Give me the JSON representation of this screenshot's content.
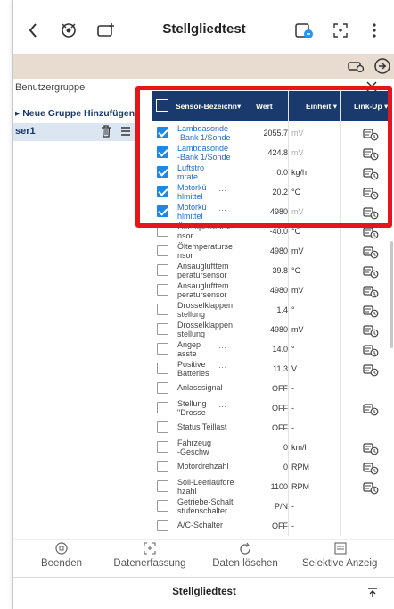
{
  "header": {
    "title": "Stellgliedtest",
    "back_icon": "chevron-left-icon",
    "icons": [
      "vehicle-settings-icon",
      "car-add-icon",
      "calendar-icon",
      "expand-icon",
      "more-vertical-icon"
    ]
  },
  "left_panel": {
    "group_label": "Benutzergruppe",
    "add_group": "▸ Neue Gruppe Hinzufügen",
    "user_name": "ser1"
  },
  "table": {
    "headers": {
      "name": "Sensor-Bezeichn▾",
      "value": "Wert",
      "unit": "Einheit ▾",
      "link": "Link-Up ▾"
    },
    "rows": [
      {
        "name": "Lambdasonde\n-Bank 1/Sonde",
        "value": "2055.7",
        "unit": "mV",
        "checked": true,
        "unit_grey": true,
        "dots": false,
        "link": true
      },
      {
        "name": "Lambdasonde\n-Bank 1/Sonde",
        "value": "424.8",
        "unit": "mV",
        "checked": true,
        "unit_grey": true,
        "dots": false,
        "link": true
      },
      {
        "name": "Luftstro\nmrate",
        "value": "0.0",
        "unit": "kg/h",
        "checked": true,
        "unit_grey": false,
        "dots": true,
        "link": true
      },
      {
        "name": "Motorkü\nhlmittel",
        "value": "20.2",
        "unit": "°C",
        "checked": true,
        "unit_grey": false,
        "dots": true,
        "link": true
      },
      {
        "name": "Motorkü\nhlmittel",
        "value": "4980",
        "unit": "mV",
        "checked": true,
        "unit_grey": true,
        "dots": true,
        "link": true
      },
      {
        "name": "Öltemperaturse\nnsor",
        "value": "-40.0",
        "unit": "°C",
        "checked": false,
        "unit_grey": false,
        "dots": false,
        "link": true
      },
      {
        "name": "Öltemperaturse\nnsor",
        "value": "4980",
        "unit": "mV",
        "checked": false,
        "unit_grey": false,
        "dots": false,
        "link": true
      },
      {
        "name": "Ansauglufttem\nperatursensor",
        "value": "39.8",
        "unit": "°C",
        "checked": false,
        "unit_grey": false,
        "dots": false,
        "link": true
      },
      {
        "name": "Ansauglufttem\nperatursensor",
        "value": "4980",
        "unit": "mV",
        "checked": false,
        "unit_grey": false,
        "dots": false,
        "link": true
      },
      {
        "name": "Drosselklappen\nstellung",
        "value": "1.4",
        "unit": "°",
        "checked": false,
        "unit_grey": false,
        "dots": false,
        "link": true
      },
      {
        "name": "Drosselklappen\nstellung",
        "value": "4980",
        "unit": "mV",
        "checked": false,
        "unit_grey": false,
        "dots": false,
        "link": true
      },
      {
        "name": "Angep\nasste",
        "value": "14.0",
        "unit": "°",
        "checked": false,
        "unit_grey": false,
        "dots": true,
        "link": true
      },
      {
        "name": "Positive\nBatteries",
        "value": "11.3",
        "unit": "V",
        "checked": false,
        "unit_grey": false,
        "dots": true,
        "link": true
      },
      {
        "name": "Anlasssignal",
        "value": "OFF",
        "unit": "-",
        "checked": false,
        "unit_grey": false,
        "dots": false,
        "link": false,
        "single": true
      },
      {
        "name": "Stellung\n\"Drosse",
        "value": "OFF",
        "unit": "-",
        "checked": false,
        "unit_grey": false,
        "dots": true,
        "link": true
      },
      {
        "name": "Status Teillast",
        "value": "OFF",
        "unit": "-",
        "checked": false,
        "unit_grey": false,
        "dots": false,
        "link": false,
        "single": true
      },
      {
        "name": "Fahrzeug\n-Geschw",
        "value": "0",
        "unit": "km/h",
        "checked": false,
        "unit_grey": false,
        "dots": true,
        "link": true
      },
      {
        "name": "Motordrehzahl",
        "value": "0",
        "unit": "RPM",
        "checked": false,
        "unit_grey": false,
        "dots": false,
        "link": true,
        "single": true
      },
      {
        "name": "Soll-Leerlaufdre\nhzahl",
        "value": "1100",
        "unit": "RPM",
        "checked": false,
        "unit_grey": false,
        "dots": false,
        "link": true
      },
      {
        "name": "Getriebe-Schalt\nstufenschalter",
        "value": "P/N",
        "unit": "-",
        "checked": false,
        "unit_grey": false,
        "dots": false,
        "link": false
      },
      {
        "name": "A/C-Schalter",
        "value": "OFF",
        "unit": "-",
        "checked": false,
        "unit_grey": false,
        "dots": false,
        "link": false,
        "single": true
      }
    ]
  },
  "actions": [
    {
      "label": "Beenden",
      "icon": "stop-circle-icon"
    },
    {
      "label": "Datenerfassung",
      "icon": "capture-icon"
    },
    {
      "label": "Daten löschen",
      "icon": "refresh-icon"
    },
    {
      "label": "Selektive Anzeig",
      "icon": "list-view-icon"
    }
  ],
  "footer": {
    "title": "Stellgliedtest"
  },
  "colors": {
    "header_bg": "#1a3a6e",
    "accent": "#1e88e5",
    "highlight": "#e8141b",
    "beige": "#e8dcd0"
  }
}
